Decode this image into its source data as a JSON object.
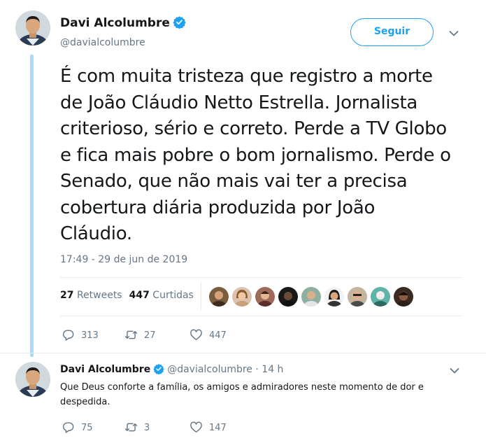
{
  "tweet": {
    "author_name": "Davi Alcolumbre",
    "author_handle": "@davialcolumbre",
    "follow_label": "Seguir",
    "text": "É com muita tristeza que registro a morte de João Cláudio Netto Estrella. Jornalista criterioso, sério e correto. Perde a TV Globo e fica mais pobre o bom jornalismo. Perde o Senado, que não mais vai ter a precisa cobertura diária produzida por João Cláudio.",
    "timestamp": "17:49 - 29 de jun de 2019",
    "retweets_count": "27",
    "retweets_label": "Retweets",
    "likes_count": "447",
    "likes_label": "Curtidas",
    "actions": {
      "replies": "313",
      "retweets": "27",
      "likes": "447"
    }
  },
  "reply": {
    "author_name": "Davi Alcolumbre",
    "author_handle": "@davialcolumbre",
    "time_ago": "· 14 h",
    "text": "Que Deus conforte a família, os amigos e admiradores neste momento de dor e despedida.",
    "actions": {
      "replies": "75",
      "retweets": "3",
      "likes": "147"
    }
  },
  "icons": {
    "verified": "verified-badge-icon",
    "menu": "chevron-down-icon",
    "reply": "reply-bubble-icon",
    "retweet": "retweet-icon",
    "like": "heart-icon"
  },
  "colors": {
    "accent": "#1da1f2",
    "secondary_text": "#657786",
    "thread_line": "#a8dbf6"
  }
}
